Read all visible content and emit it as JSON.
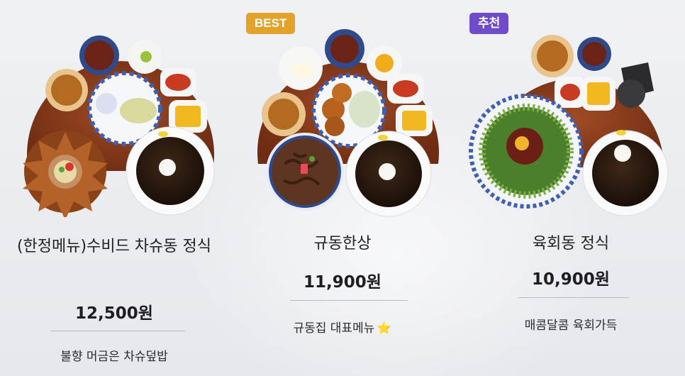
{
  "menu_items": [
    {
      "name": "(한정메뉴)수비드 차슈동 정식",
      "price": "12,500원",
      "description": "불향 머금은 차슈덮밥",
      "main_dish_icon": "chashu-donburi-icon"
    },
    {
      "badge": "BEST",
      "badge_color": "#e3a22a",
      "name": "규동한상",
      "price": "11,900원",
      "description": "규동집 대표메뉴",
      "description_icon": "⭐",
      "main_dish_icon": "gyudon-icon"
    },
    {
      "badge": "추천",
      "badge_color": "#6f4bc9",
      "name": "육회동 정식",
      "price": "10,900원",
      "description": "매콤달콤 육회가득",
      "main_dish_icon": "yukhoe-don-icon"
    }
  ],
  "colors": {
    "tray": "#8c3d1e",
    "soba_broth": "#2b1a12",
    "price_text": "#1e1e22"
  }
}
